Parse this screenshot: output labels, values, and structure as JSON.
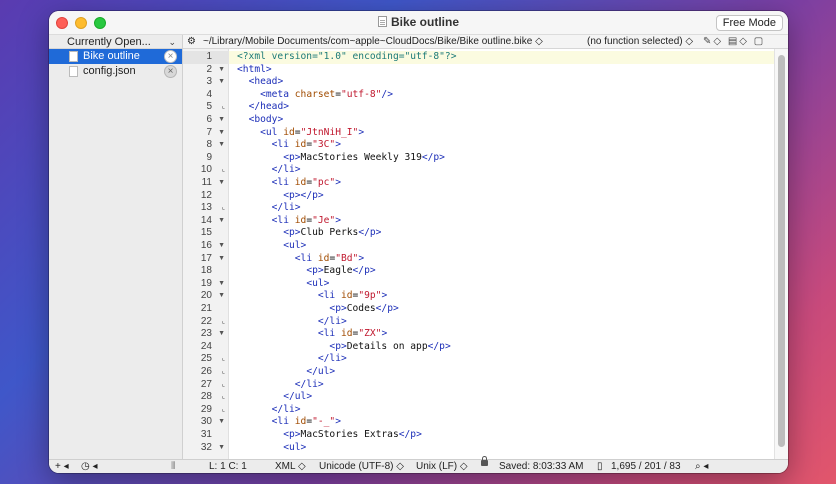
{
  "window": {
    "title": "Bike outline",
    "mode_button": "Free Mode"
  },
  "sidebar": {
    "header": "Currently Open...",
    "items": [
      {
        "label": "Bike outline",
        "active": true
      },
      {
        "label": "config.json",
        "active": false
      }
    ]
  },
  "pathbar": {
    "path": "~/Library/Mobile Documents/com~apple~CloudDocs/Bike/Bike outline.bike ◇",
    "function": "(no function selected) ◇"
  },
  "code": {
    "lines": [
      {
        "n": "1",
        "fold": "",
        "segs": [
          [
            "pi",
            "<?xml version=\"1.0\" encoding=\"utf-8\"?>"
          ]
        ]
      },
      {
        "n": "2",
        "fold": "▼",
        "segs": [
          [
            "t",
            "<html>"
          ]
        ]
      },
      {
        "n": "3",
        "fold": "▼",
        "segs": [
          [
            "x",
            "  "
          ],
          [
            "t",
            "<head>"
          ]
        ]
      },
      {
        "n": "4",
        "fold": "",
        "segs": [
          [
            "x",
            "    "
          ],
          [
            "t",
            "<meta "
          ],
          [
            "a",
            "charset"
          ],
          [
            "x",
            "="
          ],
          [
            "s",
            "\"utf-8\""
          ],
          [
            "t",
            "/>"
          ]
        ]
      },
      {
        "n": "5",
        "fold": "⌞",
        "segs": [
          [
            "x",
            "  "
          ],
          [
            "t",
            "</head>"
          ]
        ]
      },
      {
        "n": "6",
        "fold": "▼",
        "segs": [
          [
            "x",
            "  "
          ],
          [
            "t",
            "<body>"
          ]
        ]
      },
      {
        "n": "7",
        "fold": "▼",
        "segs": [
          [
            "x",
            "    "
          ],
          [
            "t",
            "<ul "
          ],
          [
            "a",
            "id"
          ],
          [
            "x",
            "="
          ],
          [
            "s",
            "\"JtnNiH_I\""
          ],
          [
            "t",
            ">"
          ]
        ]
      },
      {
        "n": "8",
        "fold": "▼",
        "segs": [
          [
            "x",
            "      "
          ],
          [
            "t",
            "<li "
          ],
          [
            "a",
            "id"
          ],
          [
            "x",
            "="
          ],
          [
            "s",
            "\"3C\""
          ],
          [
            "t",
            ">"
          ]
        ]
      },
      {
        "n": "9",
        "fold": "",
        "segs": [
          [
            "x",
            "        "
          ],
          [
            "t",
            "<p>"
          ],
          [
            "x",
            "MacStories Weekly 319"
          ],
          [
            "t",
            "</p>"
          ]
        ]
      },
      {
        "n": "10",
        "fold": "⌞",
        "segs": [
          [
            "x",
            "      "
          ],
          [
            "t",
            "</li>"
          ]
        ]
      },
      {
        "n": "11",
        "fold": "▼",
        "segs": [
          [
            "x",
            "      "
          ],
          [
            "t",
            "<li "
          ],
          [
            "a",
            "id"
          ],
          [
            "x",
            "="
          ],
          [
            "s",
            "\"pc\""
          ],
          [
            "t",
            ">"
          ]
        ]
      },
      {
        "n": "12",
        "fold": "",
        "segs": [
          [
            "x",
            "        "
          ],
          [
            "t",
            "<p></p>"
          ]
        ]
      },
      {
        "n": "13",
        "fold": "⌞",
        "segs": [
          [
            "x",
            "      "
          ],
          [
            "t",
            "</li>"
          ]
        ]
      },
      {
        "n": "14",
        "fold": "▼",
        "segs": [
          [
            "x",
            "      "
          ],
          [
            "t",
            "<li "
          ],
          [
            "a",
            "id"
          ],
          [
            "x",
            "="
          ],
          [
            "s",
            "\"Je\""
          ],
          [
            "t",
            ">"
          ]
        ]
      },
      {
        "n": "15",
        "fold": "",
        "segs": [
          [
            "x",
            "        "
          ],
          [
            "t",
            "<p>"
          ],
          [
            "x",
            "Club Perks"
          ],
          [
            "t",
            "</p>"
          ]
        ]
      },
      {
        "n": "16",
        "fold": "▼",
        "segs": [
          [
            "x",
            "        "
          ],
          [
            "t",
            "<ul>"
          ]
        ]
      },
      {
        "n": "17",
        "fold": "▼",
        "segs": [
          [
            "x",
            "          "
          ],
          [
            "t",
            "<li "
          ],
          [
            "a",
            "id"
          ],
          [
            "x",
            "="
          ],
          [
            "s",
            "\"Bd\""
          ],
          [
            "t",
            ">"
          ]
        ]
      },
      {
        "n": "18",
        "fold": "",
        "segs": [
          [
            "x",
            "            "
          ],
          [
            "t",
            "<p>"
          ],
          [
            "x",
            "Eagle"
          ],
          [
            "t",
            "</p>"
          ]
        ]
      },
      {
        "n": "19",
        "fold": "▼",
        "segs": [
          [
            "x",
            "            "
          ],
          [
            "t",
            "<ul>"
          ]
        ]
      },
      {
        "n": "20",
        "fold": "▼",
        "segs": [
          [
            "x",
            "              "
          ],
          [
            "t",
            "<li "
          ],
          [
            "a",
            "id"
          ],
          [
            "x",
            "="
          ],
          [
            "s",
            "\"9p\""
          ],
          [
            "t",
            ">"
          ]
        ]
      },
      {
        "n": "21",
        "fold": "",
        "segs": [
          [
            "x",
            "                "
          ],
          [
            "t",
            "<p>"
          ],
          [
            "x",
            "Codes"
          ],
          [
            "t",
            "</p>"
          ]
        ]
      },
      {
        "n": "22",
        "fold": "⌞",
        "segs": [
          [
            "x",
            "              "
          ],
          [
            "t",
            "</li>"
          ]
        ]
      },
      {
        "n": "23",
        "fold": "▼",
        "segs": [
          [
            "x",
            "              "
          ],
          [
            "t",
            "<li "
          ],
          [
            "a",
            "id"
          ],
          [
            "x",
            "="
          ],
          [
            "s",
            "\"ZX\""
          ],
          [
            "t",
            ">"
          ]
        ]
      },
      {
        "n": "24",
        "fold": "",
        "segs": [
          [
            "x",
            "                "
          ],
          [
            "t",
            "<p>"
          ],
          [
            "x",
            "Details on app"
          ],
          [
            "t",
            "</p>"
          ]
        ]
      },
      {
        "n": "25",
        "fold": "⌞",
        "segs": [
          [
            "x",
            "              "
          ],
          [
            "t",
            "</li>"
          ]
        ]
      },
      {
        "n": "26",
        "fold": "⌞",
        "segs": [
          [
            "x",
            "            "
          ],
          [
            "t",
            "</ul>"
          ]
        ]
      },
      {
        "n": "27",
        "fold": "⌞",
        "segs": [
          [
            "x",
            "          "
          ],
          [
            "t",
            "</li>"
          ]
        ]
      },
      {
        "n": "28",
        "fold": "⌞",
        "segs": [
          [
            "x",
            "        "
          ],
          [
            "t",
            "</ul>"
          ]
        ]
      },
      {
        "n": "29",
        "fold": "⌞",
        "segs": [
          [
            "x",
            "      "
          ],
          [
            "t",
            "</li>"
          ]
        ]
      },
      {
        "n": "30",
        "fold": "▼",
        "segs": [
          [
            "x",
            "      "
          ],
          [
            "t",
            "<li "
          ],
          [
            "a",
            "id"
          ],
          [
            "x",
            "="
          ],
          [
            "s",
            "\"-_\""
          ],
          [
            "t",
            ">"
          ]
        ]
      },
      {
        "n": "31",
        "fold": "",
        "segs": [
          [
            "x",
            "        "
          ],
          [
            "t",
            "<p>"
          ],
          [
            "x",
            "MacStories Extras"
          ],
          [
            "t",
            "</p>"
          ]
        ]
      },
      {
        "n": "32",
        "fold": "▼",
        "segs": [
          [
            "x",
            "        "
          ],
          [
            "t",
            "<ul>"
          ]
        ]
      }
    ]
  },
  "status": {
    "add": "+ ◂",
    "history": "◷ ◂",
    "position": "L: 1 C: 1",
    "language": "XML ◇",
    "encoding": "Unicode (UTF-8) ◇",
    "line_endings": "Unix (LF) ◇",
    "saved": "Saved: 8:03:33 AM",
    "counts": "1,695 / 201 / 83",
    "search": "⌕ ◂"
  },
  "colors": {
    "tag": "#1d2fb8",
    "attribute": "#a04b00",
    "string": "#c0182e",
    "selection": "#1f6ad8"
  }
}
